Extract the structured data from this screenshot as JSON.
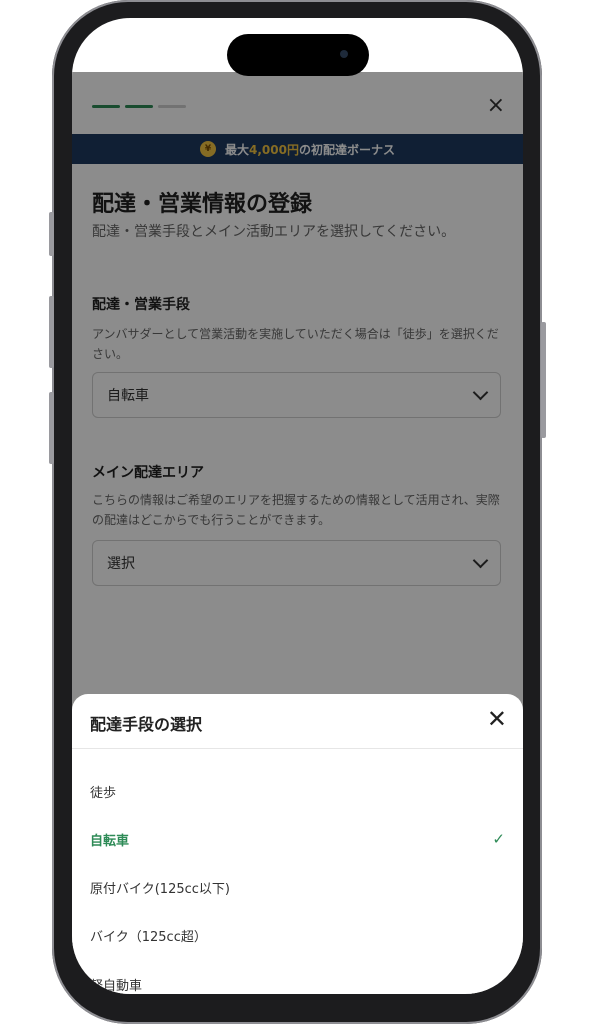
{
  "header": {
    "progress_colors": [
      "#2e8b57",
      "#2e8b57",
      "#d0d0d0"
    ],
    "close_glyph": "×"
  },
  "bonus_banner": {
    "coin_glyph": "¥",
    "prefix": "最大",
    "amount": "4,000円",
    "suffix": "の初配達ボーナス"
  },
  "form": {
    "title": "配達・営業情報の登録",
    "subtitle": "配達・営業手段とメイン活動エリアを選択してください。",
    "method": {
      "label": "配達・営業手段",
      "help": "アンバサダーとして営業活動を実施していただく場合は「徒歩」を選択ください。",
      "selected_value": "自転車"
    },
    "area": {
      "label": "メイン配達エリア",
      "help": "こちらの情報はご希望のエリアを把握するための情報として活用され、実際の配達はどこからでも行うことができます。",
      "selected_value": "選択"
    }
  },
  "sheet": {
    "title": "配達手段の選択",
    "close_glyph": "✕",
    "options": [
      {
        "label": "徒歩",
        "selected": false
      },
      {
        "label": "自転車",
        "selected": true
      },
      {
        "label": "原付バイク(125cc以下)",
        "selected": false
      },
      {
        "label": "バイク（125cc超）",
        "selected": false
      },
      {
        "label": "軽自動車",
        "selected": false
      }
    ],
    "check_glyph": "✓"
  },
  "colors": {
    "accent_green": "#2e8b57",
    "banner_navy": "#1e3a5f",
    "coin_gold": "#f4c542"
  }
}
